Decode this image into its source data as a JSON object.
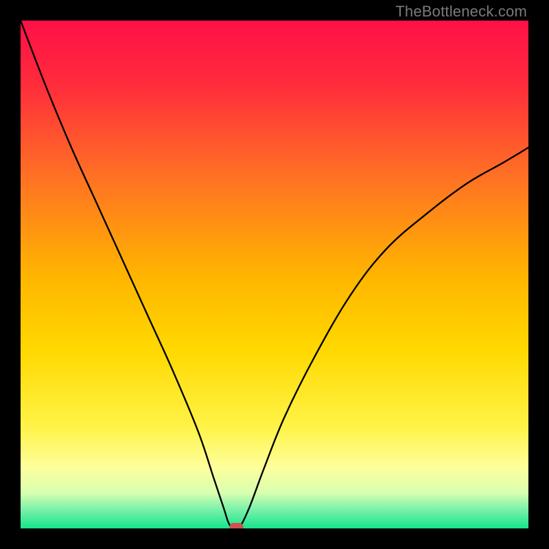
{
  "watermark": "TheBottleneck.com",
  "chart_data": {
    "type": "line",
    "title": "",
    "xlabel": "",
    "ylabel": "",
    "xlim": [
      0,
      100
    ],
    "ylim": [
      0,
      100
    ],
    "grid": false,
    "series": [
      {
        "name": "curve",
        "x": [
          0,
          5,
          10,
          15,
          20,
          25,
          30,
          35,
          38,
          40,
          41,
          42,
          43,
          45,
          48,
          52,
          58,
          65,
          72,
          80,
          88,
          95,
          100
        ],
        "values": [
          100,
          87,
          75,
          64,
          53,
          42,
          31,
          19,
          10,
          4,
          1,
          0,
          0,
          4,
          12,
          22,
          34,
          46,
          55,
          62,
          68,
          72,
          75
        ]
      }
    ],
    "marker": {
      "x": 42.5,
      "y": 0
    },
    "background_gradient": {
      "stops": [
        {
          "offset": 0,
          "color": "#ff1048"
        },
        {
          "offset": 0.12,
          "color": "#ff2a3c"
        },
        {
          "offset": 0.3,
          "color": "#ff6e25"
        },
        {
          "offset": 0.5,
          "color": "#ffb400"
        },
        {
          "offset": 0.65,
          "color": "#ffd900"
        },
        {
          "offset": 0.8,
          "color": "#fff347"
        },
        {
          "offset": 0.88,
          "color": "#feff9c"
        },
        {
          "offset": 0.93,
          "color": "#d8ffb0"
        },
        {
          "offset": 0.965,
          "color": "#74f0a8"
        },
        {
          "offset": 1.0,
          "color": "#16e58d"
        }
      ]
    }
  }
}
